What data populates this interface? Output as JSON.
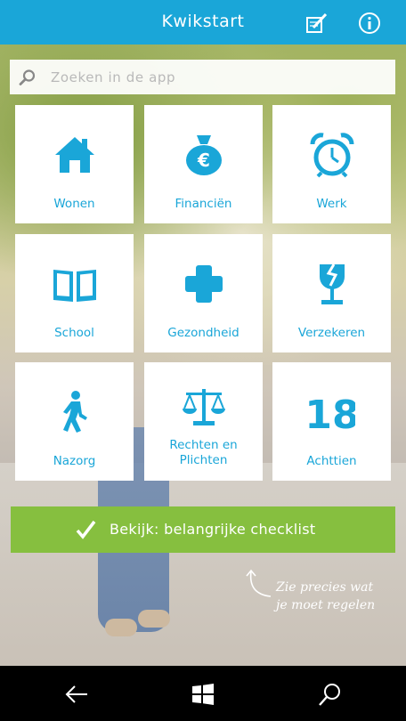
{
  "header": {
    "title": "Kwikstart",
    "notes_icon": "notebook-pencil-icon",
    "info_icon": "info-icon"
  },
  "search": {
    "placeholder": "Zoeken in de app",
    "icon": "search-icon"
  },
  "tiles": [
    {
      "label": "Wonen",
      "icon": "house-icon"
    },
    {
      "label": "Financiën",
      "icon": "money-bag-icon"
    },
    {
      "label": "Werk",
      "icon": "alarm-clock-icon"
    },
    {
      "label": "School",
      "icon": "book-icon"
    },
    {
      "label": "Gezondheid",
      "icon": "medical-cross-icon"
    },
    {
      "label": "Verzekeren",
      "icon": "broken-glass-icon"
    },
    {
      "label": "Nazorg",
      "icon": "walking-person-icon"
    },
    {
      "label": "Rechten en Plichten",
      "icon": "scales-icon"
    },
    {
      "label": "Achttien",
      "icon": "eighteen-icon",
      "icon_text": "18"
    }
  ],
  "checklist": {
    "label": "Bekijk: belangrijke checklist",
    "icon": "checkmark-icon"
  },
  "hint": {
    "line1": "Zie precies wat",
    "line2": "je moet regelen"
  },
  "navbar": {
    "back_icon": "back-arrow-icon",
    "home_icon": "windows-logo-icon",
    "search_icon": "search-icon"
  },
  "colors": {
    "accent": "#1aa6d8",
    "green": "#86bf3f"
  }
}
